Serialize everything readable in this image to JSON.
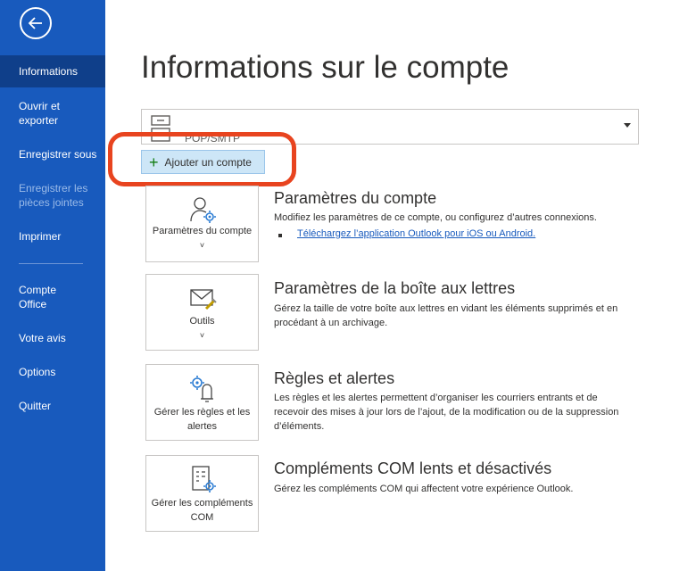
{
  "sidebar": {
    "items": [
      {
        "label": "Informations"
      },
      {
        "label": "Ouvrir et exporter"
      },
      {
        "label": "Enregistrer sous"
      },
      {
        "label": "Enregistrer les pièces jointes"
      },
      {
        "label": "Imprimer"
      },
      {
        "label": "Compte Office"
      },
      {
        "label": "Votre avis"
      },
      {
        "label": "Options"
      },
      {
        "label": "Quitter"
      }
    ],
    "colors": {
      "background": "#185abd",
      "active": "#0f3f8a"
    }
  },
  "main": {
    "title": "Informations sur le compte",
    "account_partial": "POP/SMTP",
    "add_account_label": "Ajouter un compte",
    "sections": [
      {
        "tile_label": "Paramètres du compte",
        "title": "Paramètres du compte",
        "description": "Modifiez les paramètres de ce compte, ou configurez d’autres connexions.",
        "link": "Téléchargez l’application Outlook pour iOS ou Android."
      },
      {
        "tile_label": "Outils",
        "title": "Paramètres de la boîte aux lettres",
        "description": "Gérez la taille de votre boîte aux lettres en vidant les éléments supprimés et en procédant à un archivage."
      },
      {
        "tile_label": "Gérer les règles et les alertes",
        "title": "Règles et alertes",
        "description": "Les règles et les alertes permettent d’organiser les courriers entrants et de recevoir des mises à jour lors de l’ajout, de la modification ou de la suppression d’éléments."
      },
      {
        "tile_label": "Gérer les compléments COM",
        "title": "Compléments COM lents et désactivés",
        "description": "Gérez les compléments COM qui affectent votre expérience Outlook."
      }
    ]
  },
  "icons": [
    "back-arrow-icon",
    "account-file-icon",
    "plus-icon",
    "user-gear-icon",
    "mail-tools-icon",
    "gear-bell-icon",
    "document-gear-icon",
    "chevron-down-icon"
  ],
  "accent_colors": {
    "highlight": "#e8441f",
    "link": "#185abd",
    "add_button": "#cde6f7"
  }
}
